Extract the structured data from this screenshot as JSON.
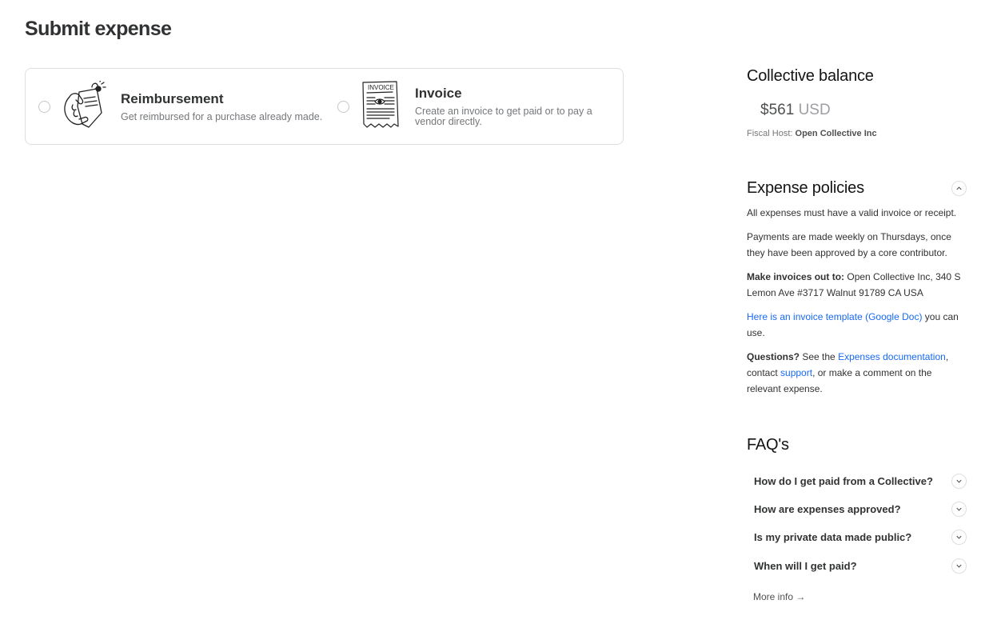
{
  "page": {
    "title": "Submit expense"
  },
  "expense_types": [
    {
      "title": "Reimbursement",
      "description": "Get reimbursed for a purchase already made."
    },
    {
      "title": "Invoice",
      "description": "Create an invoice to get paid or to pay a vendor directly.",
      "illustration_text": "INVOICE"
    }
  ],
  "balance": {
    "title": "Collective balance",
    "amount": "$561",
    "currency": "USD",
    "fiscal_host_label": "Fiscal Host:",
    "fiscal_host_name": "Open Collective Inc"
  },
  "policies": {
    "title": "Expense policies",
    "p1": "All expenses must have a valid invoice or receipt.",
    "p2": "Payments are made weekly on Thursdays, once they have been approved by a core contributor.",
    "p3_bold": "Make invoices out to:",
    "p3_text": " Open Collective Inc, 340 S Lemon Ave #3717 Walnut 91789 CA USA",
    "p4_link": "Here is an invoice template (Google Doc)",
    "p4_text": " you can use.",
    "p5_bold": "Questions?",
    "p5_text1": " See the ",
    "p5_link1": "Expenses documentation",
    "p5_text2": ", contact ",
    "p5_link2": "support",
    "p5_text3": ", or make a comment on the relevant expense."
  },
  "faq": {
    "title": "FAQ's",
    "items": [
      "How do I get paid from a Collective?",
      "How are expenses approved?",
      "Is my private data made public?",
      "When will I get paid?"
    ],
    "more_info": "More info →"
  },
  "colors": {
    "link": "#1869f5",
    "border": "#dcdee0",
    "text": "#313233"
  }
}
